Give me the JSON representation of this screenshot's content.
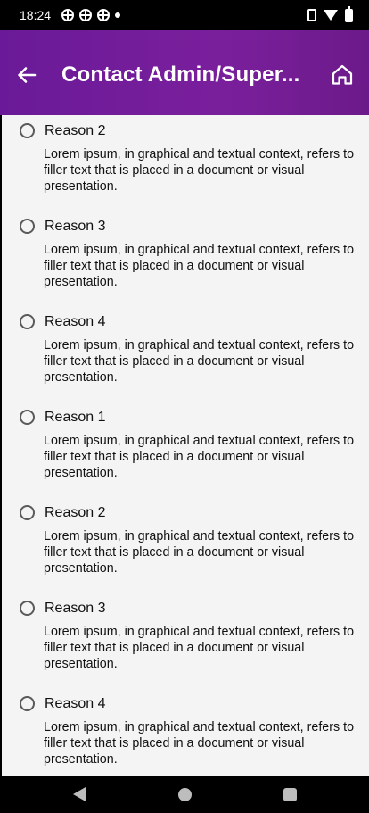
{
  "status_bar": {
    "time": "18:24",
    "left_icons": [
      "dpad-icon",
      "dpad-icon",
      "dpad-icon",
      "dot-icon"
    ],
    "right_icons": [
      "vibrate-icon",
      "wifi-icon",
      "battery-icon"
    ]
  },
  "app_bar": {
    "title": "Contact Admin/Super...",
    "back_icon": "arrow-left-icon",
    "home_icon": "home-icon",
    "gradient_colors": [
      "#6a1a98",
      "#7a1f9c"
    ]
  },
  "reasons": [
    {
      "title": "Reason 2",
      "description": "Lorem ipsum, in graphical and textual context, refers to filler text that is placed in a document or visual presentation."
    },
    {
      "title": "Reason 3",
      "description": "Lorem ipsum, in graphical and textual context, refers to filler text that is placed in a document or visual presentation."
    },
    {
      "title": "Reason 4",
      "description": "Lorem ipsum, in graphical and textual context, refers to filler text that is placed in a document or visual presentation."
    },
    {
      "title": "Reason 1",
      "description": "Lorem ipsum, in graphical and textual context, refers to filler text that is placed in a document or visual presentation."
    },
    {
      "title": "Reason 2",
      "description": "Lorem ipsum, in graphical and textual context, refers to filler text that is placed in a document or visual presentation."
    },
    {
      "title": "Reason 3",
      "description": "Lorem ipsum, in graphical and textual context, refers to filler text that is placed in a document or visual presentation."
    },
    {
      "title": "Reason 4",
      "description": "Lorem ipsum, in graphical and textual context, refers to filler text that is placed in a document or visual presentation."
    }
  ],
  "nav_bar": {
    "buttons": [
      "nav-back-icon",
      "nav-home-icon",
      "nav-recents-icon"
    ]
  },
  "colors": {
    "app_bar": "#7a1f9c",
    "content_bg": "#f4f4f4",
    "radio_border": "#5a5a5a"
  }
}
